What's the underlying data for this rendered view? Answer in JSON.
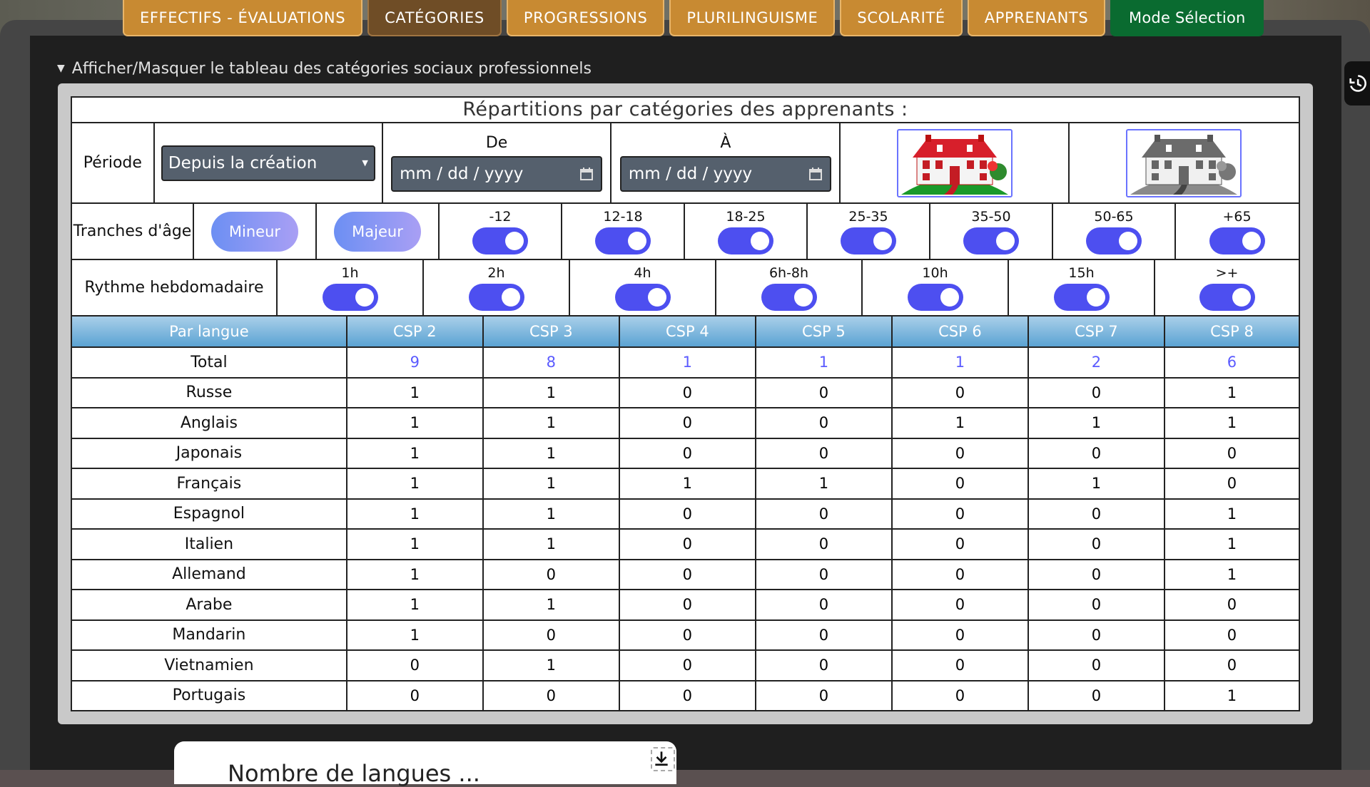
{
  "nav": {
    "tabs": [
      {
        "label": "EFFECTIFS - ÉVALUATIONS"
      },
      {
        "label": "CATÉGORIES"
      },
      {
        "label": "PROGRESSIONS"
      },
      {
        "label": "PLURILINGUISME"
      },
      {
        "label": "SCOLARITÉ"
      },
      {
        "label": "APPRENANTS"
      }
    ],
    "mode_button": "Mode Sélection"
  },
  "section_toggle": "Afficher/Masquer le tableau des catégories sociaux professionnels",
  "table_title": "Répartitions par catégories des apprenants :",
  "period": {
    "label": "Période",
    "select_value": "Depuis la création",
    "from_label": "De",
    "from_placeholder": "mm / dd / yyyy",
    "to_label": "À",
    "to_placeholder": "mm / dd / yyyy"
  },
  "age": {
    "label": "Tranches d'âge",
    "minor": "Mineur",
    "major": "Majeur",
    "ranges": [
      "-12",
      "12-18",
      "18-25",
      "25-35",
      "35-50",
      "50-65",
      "+65"
    ]
  },
  "rhythm": {
    "label": "Rythme hebdomadaire",
    "options": [
      "1h",
      "2h",
      "4h",
      "6h-8h",
      "10h",
      "15h",
      ">+"
    ]
  },
  "grid": {
    "headers": [
      "Par langue",
      "CSP 2",
      "CSP 3",
      "CSP 4",
      "CSP 5",
      "CSP 6",
      "CSP 7",
      "CSP 8"
    ],
    "total": {
      "label": "Total",
      "values": [
        "9",
        "8",
        "1",
        "1",
        "1",
        "2",
        "6"
      ]
    },
    "rows": [
      {
        "label": "Russe",
        "values": [
          "1",
          "1",
          "0",
          "0",
          "0",
          "0",
          "1"
        ]
      },
      {
        "label": "Anglais",
        "values": [
          "1",
          "1",
          "0",
          "0",
          "1",
          "1",
          "1"
        ]
      },
      {
        "label": "Japonais",
        "values": [
          "1",
          "1",
          "0",
          "0",
          "0",
          "0",
          "0"
        ]
      },
      {
        "label": "Français",
        "values": [
          "1",
          "1",
          "1",
          "1",
          "0",
          "1",
          "0"
        ]
      },
      {
        "label": "Espagnol",
        "values": [
          "1",
          "1",
          "0",
          "0",
          "0",
          "0",
          "1"
        ]
      },
      {
        "label": "Italien",
        "values": [
          "1",
          "1",
          "0",
          "0",
          "0",
          "0",
          "1"
        ]
      },
      {
        "label": "Allemand",
        "values": [
          "1",
          "0",
          "0",
          "0",
          "0",
          "0",
          "1"
        ]
      },
      {
        "label": "Arabe",
        "values": [
          "1",
          "1",
          "0",
          "0",
          "0",
          "0",
          "0"
        ]
      },
      {
        "label": "Mandarin",
        "values": [
          "1",
          "0",
          "0",
          "0",
          "0",
          "0",
          "0"
        ]
      },
      {
        "label": "Vietnamien",
        "values": [
          "0",
          "1",
          "0",
          "0",
          "0",
          "0",
          "0"
        ]
      },
      {
        "label": "Portugais",
        "values": [
          "0",
          "0",
          "0",
          "0",
          "0",
          "0",
          "1"
        ]
      }
    ]
  },
  "bottom_card_text": "Nombre de langues ... "
}
